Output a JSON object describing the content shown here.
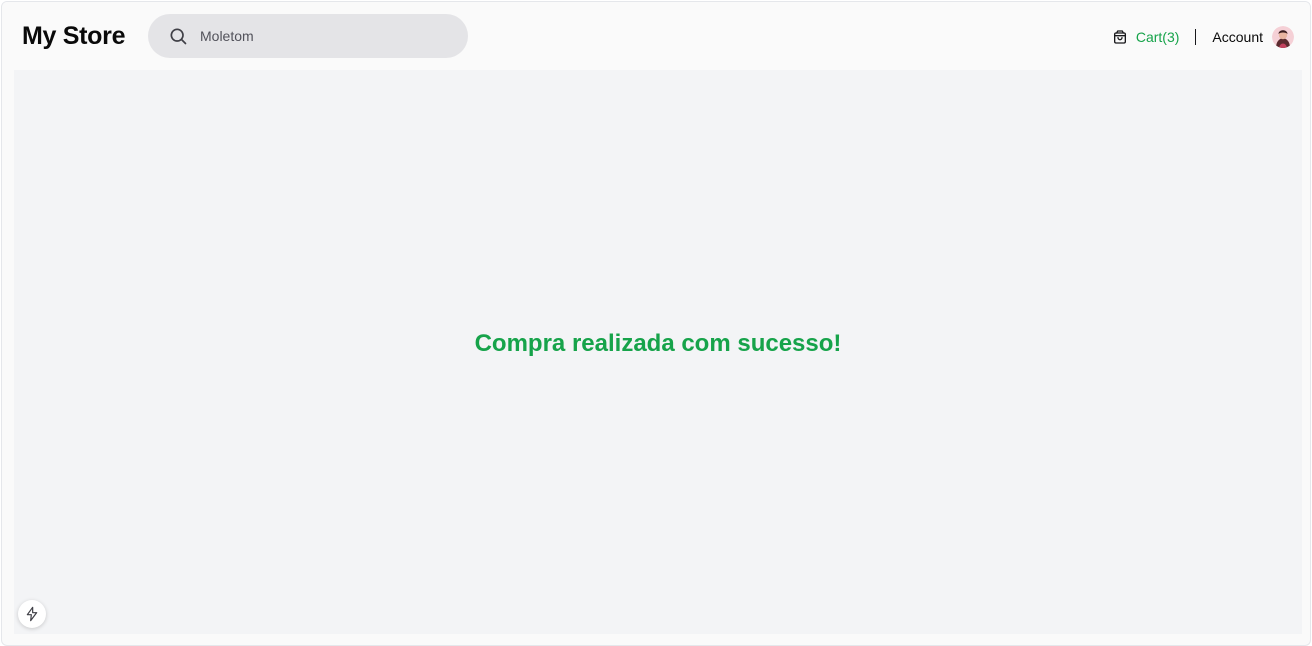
{
  "header": {
    "brand": "My Store",
    "search": {
      "value": "",
      "placeholder": "Moletom"
    },
    "cart": {
      "label": "Cart(3)",
      "icon": "shopping-bag-icon"
    },
    "account": {
      "label": "Account",
      "avatar": "user-avatar"
    }
  },
  "main": {
    "message": "Compra realizada com sucesso!"
  },
  "dev_tools": {
    "icon": "lightning-bolt-icon"
  },
  "colors": {
    "accent": "#16a34a",
    "page_background": "#f3f4f6",
    "search_background": "#e4e4e7",
    "text": "#0a0a0a"
  }
}
